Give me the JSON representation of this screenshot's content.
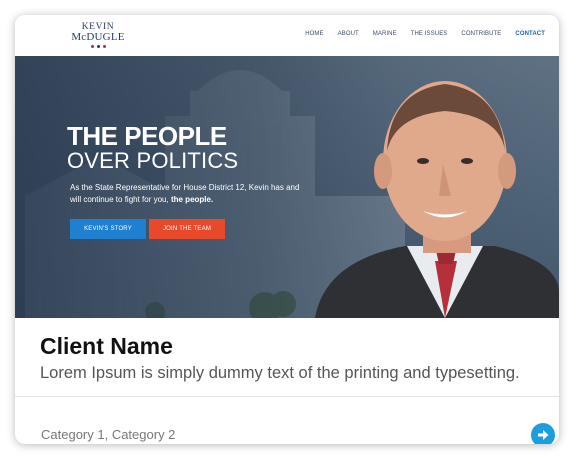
{
  "site": {
    "logo": {
      "line1": "KEVIN",
      "line2": "McDUGLE",
      "dot_colors": [
        "#c8232c",
        "#2a3c66",
        "#c8232c"
      ]
    },
    "nav": {
      "items": [
        {
          "label": "HOME"
        },
        {
          "label": "ABOUT"
        },
        {
          "label": "MARINE"
        },
        {
          "label": "THE ISSUES"
        },
        {
          "label": "CONTRIBUTE"
        },
        {
          "label": "CONTACT",
          "active": true
        }
      ]
    }
  },
  "hero": {
    "headline": "THE PEOPLE",
    "subheadline": "OVER POLITICS",
    "body": "As the State Representative for House District 12, Kevin has and will continue to fight for you,",
    "body_emphasis": "the people.",
    "buttons": {
      "story": "KEVIN'S STORY",
      "join": "JOIN THE TEAM"
    }
  },
  "card": {
    "client_name": "Client Name",
    "description": "Lorem Ipsum is simply dummy text of the printing and typesetting.",
    "categories": "Category 1, Category 2"
  },
  "icons": {
    "arrow": "arrow-right-circle-icon"
  },
  "colors": {
    "accent_blue": "#1f7fd0",
    "accent_red": "#e8492b",
    "arrow_blue": "#1c9de0",
    "nav_active": "#1a63b8"
  }
}
